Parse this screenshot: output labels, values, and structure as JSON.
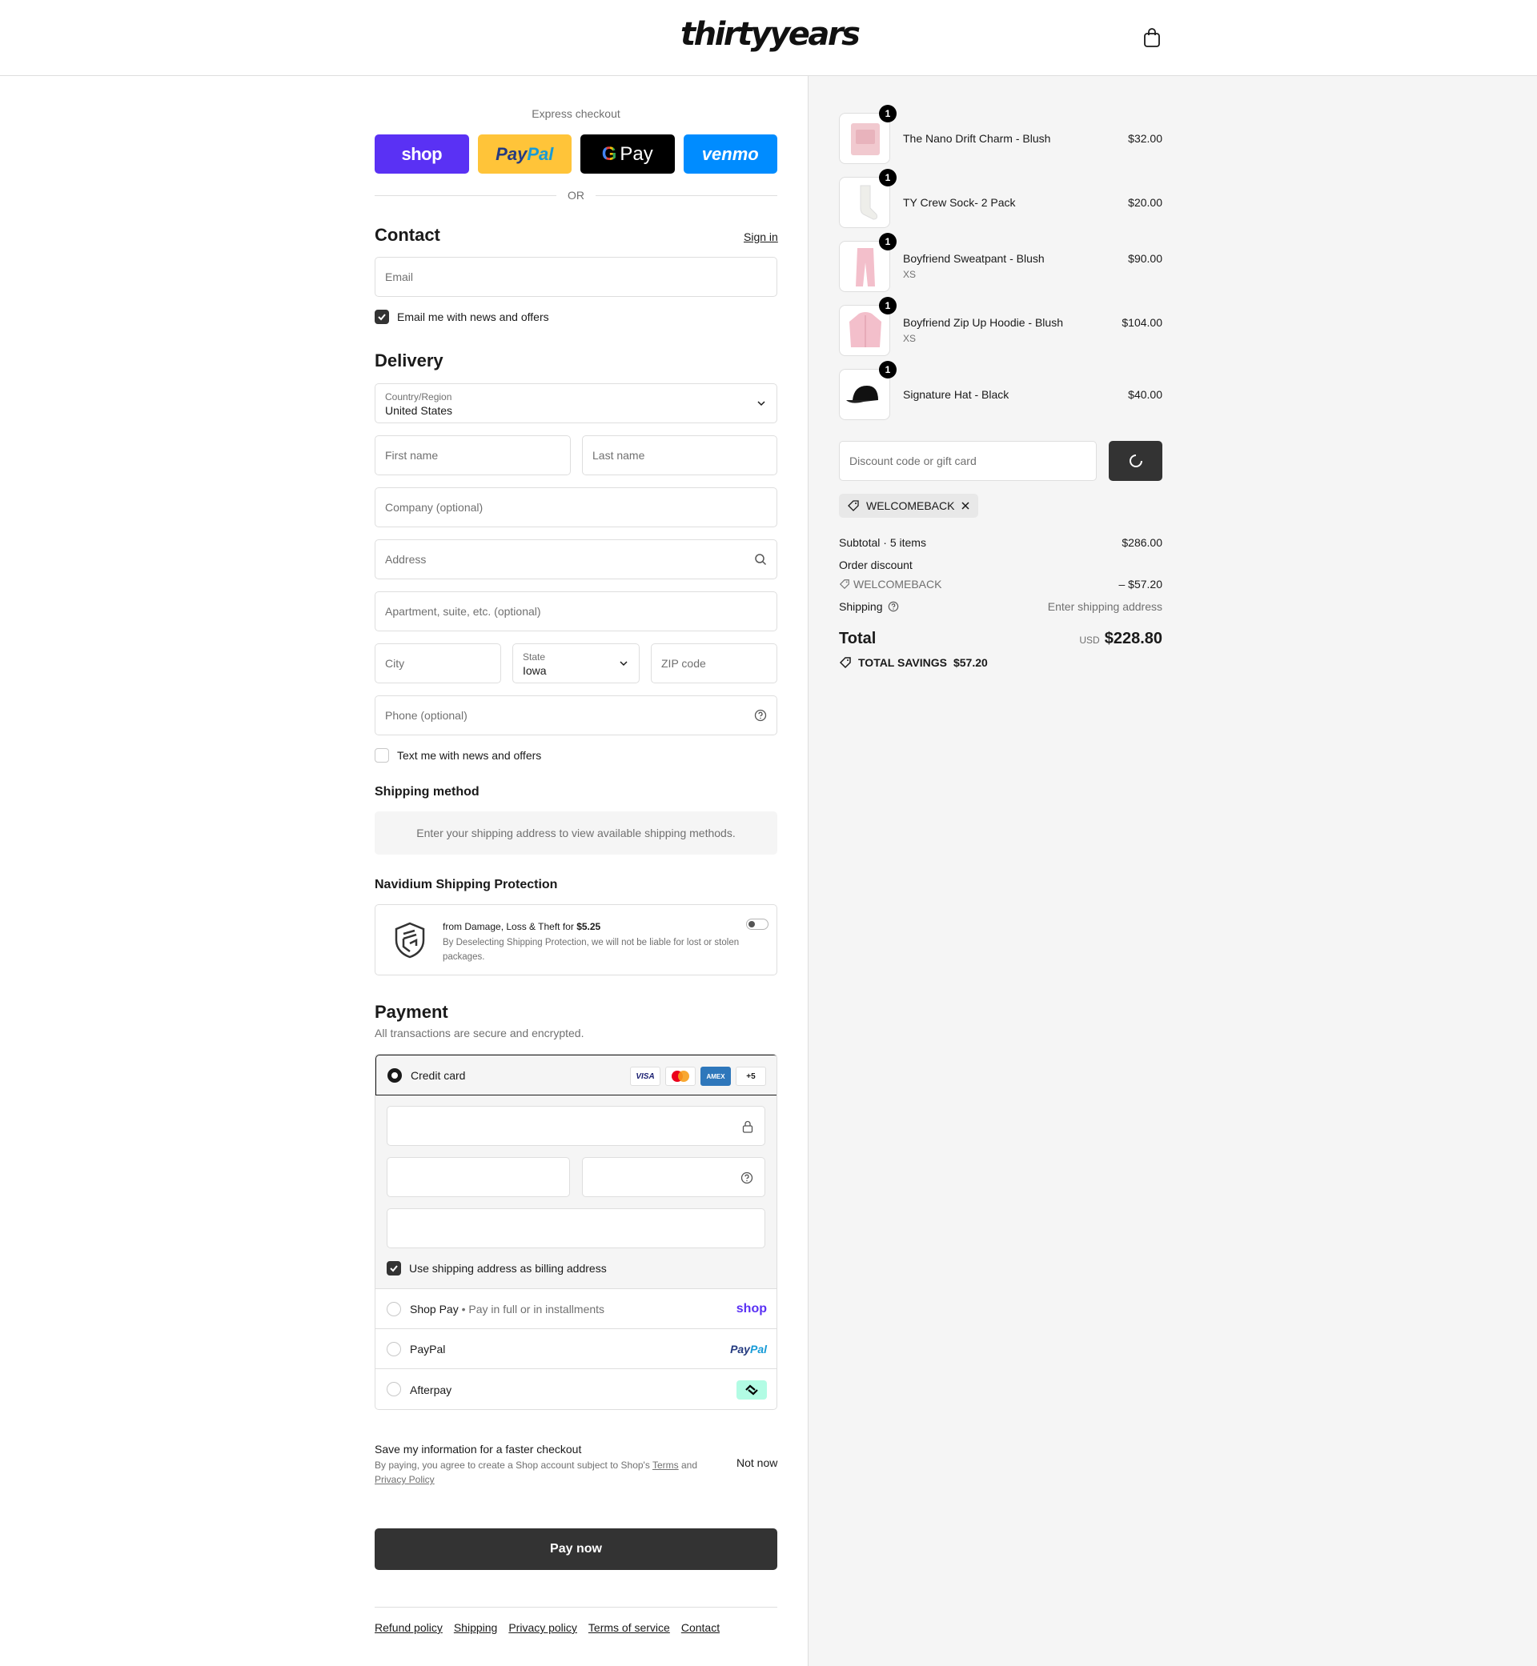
{
  "header": {
    "logo_text": "thirtyyears",
    "cart_icon": "shopping-bag-icon"
  },
  "express": {
    "label": "Express checkout",
    "buttons": {
      "shop": "shop",
      "paypal_a": "Pay",
      "paypal_b": "Pal",
      "gpay_g": "G",
      "gpay_text": "Pay",
      "venmo": "venmo"
    },
    "or": "OR"
  },
  "contact": {
    "title": "Contact",
    "sign_in": "Sign in",
    "email_placeholder": "Email",
    "newsletter_label": "Email me with news and offers",
    "newsletter_checked": true
  },
  "delivery": {
    "title": "Delivery",
    "country_label": "Country/Region",
    "country_value": "United States",
    "first_name_placeholder": "First name",
    "last_name_placeholder": "Last name",
    "company_placeholder": "Company (optional)",
    "address_placeholder": "Address",
    "apartment_placeholder": "Apartment, suite, etc. (optional)",
    "city_placeholder": "City",
    "state_label": "State",
    "state_value": "Iowa",
    "zip_placeholder": "ZIP code",
    "phone_placeholder": "Phone (optional)",
    "sms_label": "Text me with news and offers",
    "sms_checked": false
  },
  "shipping_method": {
    "title": "Shipping method",
    "message": "Enter your shipping address to view available shipping methods."
  },
  "protection": {
    "title": "Navidium Shipping Protection",
    "line1": "from Damage, Loss & Theft for ",
    "price": "$5.25",
    "description": "By Deselecting Shipping Protection, we will not be liable for lost or stolen packages.",
    "enabled": false
  },
  "payment": {
    "title": "Payment",
    "subtitle": "All transactions are secure and encrypted.",
    "credit_card_label": "Credit card",
    "card_logos": {
      "visa": "VISA",
      "amex": "AMEX",
      "more": "+5"
    },
    "billing_same_label": "Use shipping address as billing address",
    "billing_same_checked": true,
    "shop_pay_label": "Shop Pay",
    "shop_pay_sub": "Pay in full or in installments",
    "shop_pay_brand": "shop",
    "paypal_label": "PayPal",
    "paypal_brand_a": "Pay",
    "paypal_brand_b": "Pal",
    "afterpay_label": "Afterpay"
  },
  "save_info": {
    "title": "Save my information for a faster checkout",
    "desc_prefix": "By paying, you agree to create a Shop account subject to Shop's ",
    "terms": "Terms",
    "and": " and ",
    "privacy": "Privacy Policy",
    "not_now": "Not now"
  },
  "pay_now_label": "Pay now",
  "footer_links": [
    "Refund policy",
    "Shipping",
    "Privacy policy",
    "Terms of service",
    "Contact"
  ],
  "order": {
    "items": [
      {
        "name": "The Nano Drift Charm - Blush",
        "variant": "",
        "price": "$32.00",
        "qty": "1",
        "color": "#f1c9cf"
      },
      {
        "name": "TY Crew Sock- 2 Pack",
        "variant": "",
        "price": "$20.00",
        "qty": "1",
        "color": "#eeeeea"
      },
      {
        "name": "Boyfriend Sweatpant - Blush",
        "variant": "XS",
        "price": "$90.00",
        "qty": "1",
        "color": "#f3bfcb"
      },
      {
        "name": "Boyfriend Zip Up Hoodie - Blush",
        "variant": "XS",
        "price": "$104.00",
        "qty": "1",
        "color": "#f3bfcb"
      },
      {
        "name": "Signature Hat - Black",
        "variant": "",
        "price": "$40.00",
        "qty": "1",
        "color": "#111111"
      }
    ],
    "discount_placeholder": "Discount code or gift card",
    "applied_code": "WELCOMEBACK",
    "subtotal_label": "Subtotal · 5 items",
    "subtotal_value": "$286.00",
    "order_discount_label": "Order discount",
    "order_discount_code": "WELCOMEBACK",
    "order_discount_value": "– $57.20",
    "shipping_label": "Shipping",
    "shipping_value": "Enter shipping address",
    "total_label": "Total",
    "currency": "USD",
    "total_value": "$228.80",
    "savings_label": "TOTAL SAVINGS",
    "savings_value": "$57.20"
  }
}
